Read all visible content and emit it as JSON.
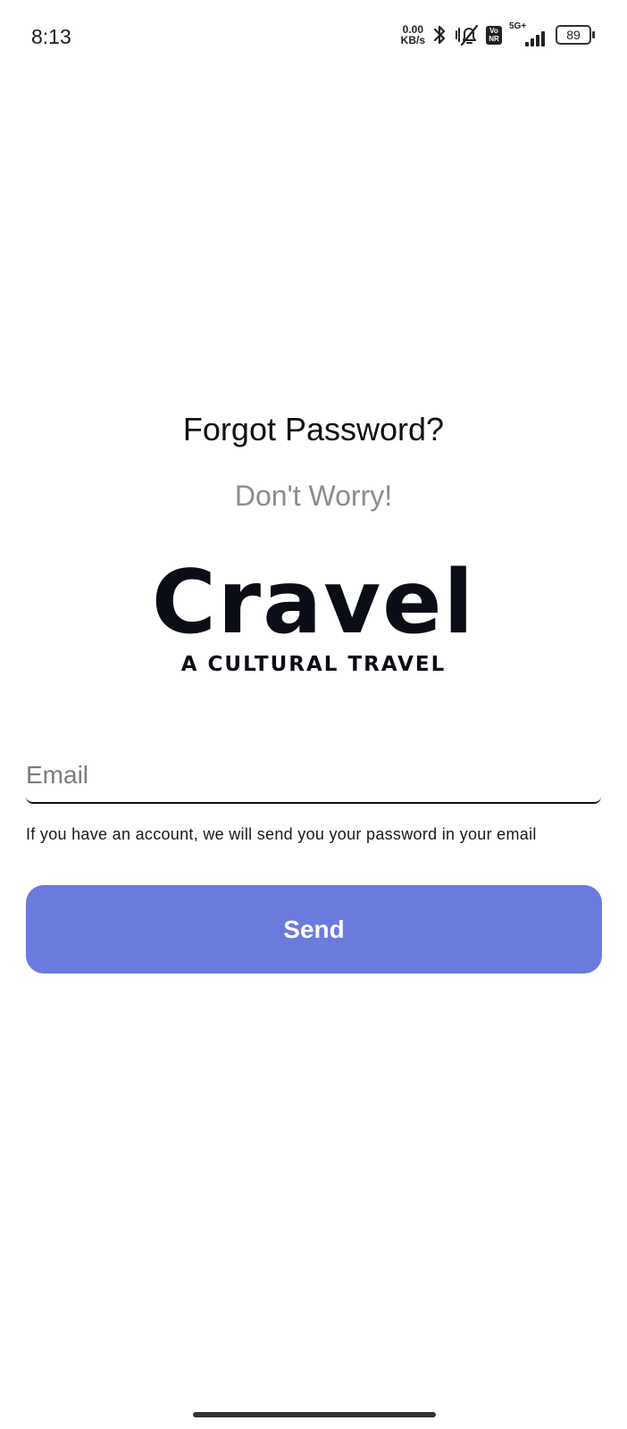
{
  "status_bar": {
    "time": "8:13",
    "network_speed_value": "0.00",
    "network_speed_unit": "KB/s",
    "volte_top": "Vo",
    "volte_bottom": "NR",
    "network_type": "5G+",
    "battery_level": "89",
    "icons": [
      "bluetooth-icon",
      "silent-mode-icon",
      "volte-icon",
      "signal-icon",
      "battery-icon"
    ]
  },
  "main": {
    "title": "Forgot Password?",
    "subtitle": "Don't Worry!",
    "logo_word": "Cravel",
    "logo_tagline": "A CULTURAL TRAVEL",
    "email_placeholder": "Email",
    "helper_text": "If you have an account, we will send you your password in your email",
    "send_label": "Send"
  },
  "colors": {
    "primary_button": "#6b7bdd",
    "subtitle_gray": "#8c8c8c",
    "logo_dark": "#0b0d16"
  }
}
